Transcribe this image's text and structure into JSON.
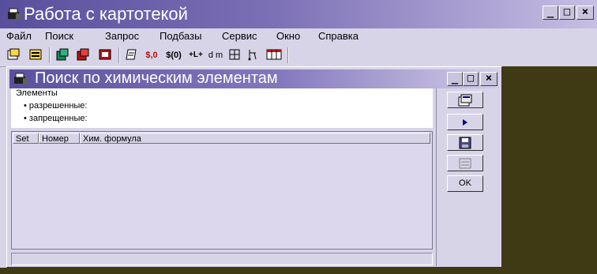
{
  "window": {
    "title": "Работа с картотекой",
    "min": "_",
    "max": "□",
    "close": "×"
  },
  "menu": [
    "Файл",
    "Поиск",
    "Запрос",
    "Подбазы",
    "Сервис",
    "Окно",
    "Справка"
  ],
  "toolbar": {
    "t1": "$,0",
    "t2": "$(0)",
    "t3": "+L+",
    "t4": "d m"
  },
  "child": {
    "title": "Поиск по химическим элементам",
    "min": "_",
    "max": "□",
    "close": "×",
    "elements": {
      "heading": "Элементы",
      "allowed": "• разрешенные:",
      "forbidden": "• запрещенные:"
    },
    "columns": [
      "Set",
      "Номер",
      "Хим. формула"
    ],
    "ok_label": "OK"
  }
}
